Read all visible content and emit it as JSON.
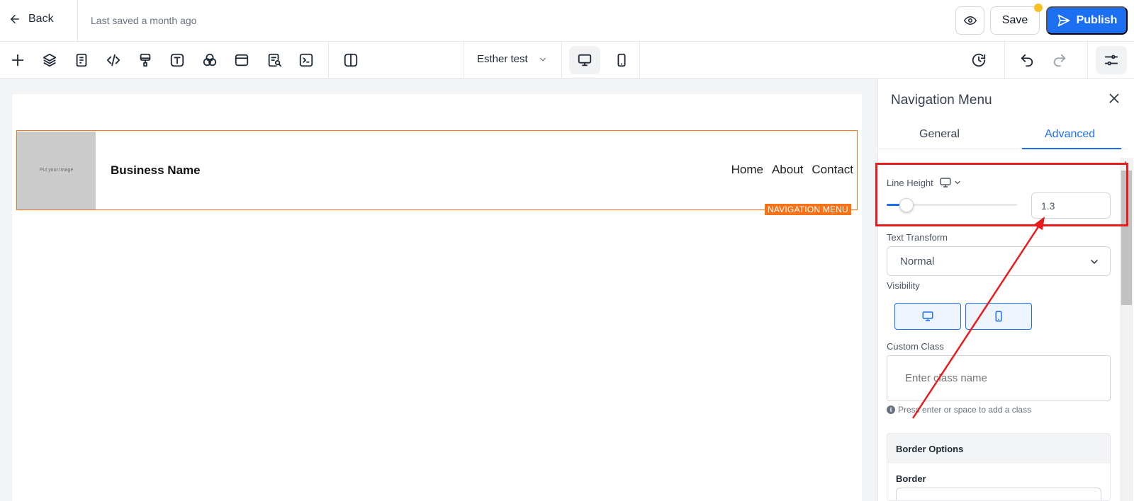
{
  "header": {
    "back_label": "Back",
    "saved_status": "Last saved a month ago",
    "save_label": "Save",
    "publish_label": "Publish"
  },
  "toolbar": {
    "tools": [
      "plus-icon",
      "layers-icon",
      "pages-icon",
      "code-icon",
      "brush-icon",
      "text-icon",
      "color-circles-icon",
      "section-icon",
      "seo-search-icon",
      "terminal-icon",
      "split-view-icon"
    ],
    "page_selector": "Esther test",
    "devices": [
      "desktop",
      "mobile"
    ],
    "active_device": "desktop"
  },
  "canvas": {
    "image_placeholder": "Put your Image",
    "business_name": "Business Name",
    "nav_links": [
      "Home",
      "About",
      "Contact"
    ],
    "element_tag": "NAVIGATION MENU"
  },
  "panel": {
    "title": "Navigation Menu",
    "tabs": [
      "General",
      "Advanced"
    ],
    "active_tab": "Advanced",
    "line_height": {
      "label": "Line Height",
      "value": "1.3",
      "slider_fraction": 0.1
    },
    "text_transform": {
      "label": "Text Transform",
      "value": "Normal"
    },
    "visibility": {
      "label": "Visibility",
      "options": [
        "desktop",
        "mobile"
      ]
    },
    "custom_class": {
      "label": "Custom Class",
      "placeholder": "Enter class name",
      "hint": "Press enter or space to add a class"
    },
    "border_options": {
      "title": "Border Options",
      "border_label": "Border"
    }
  },
  "colors": {
    "accent": "#1d6ff2",
    "selection": "#f97316",
    "annotation": "#e81c1c"
  }
}
